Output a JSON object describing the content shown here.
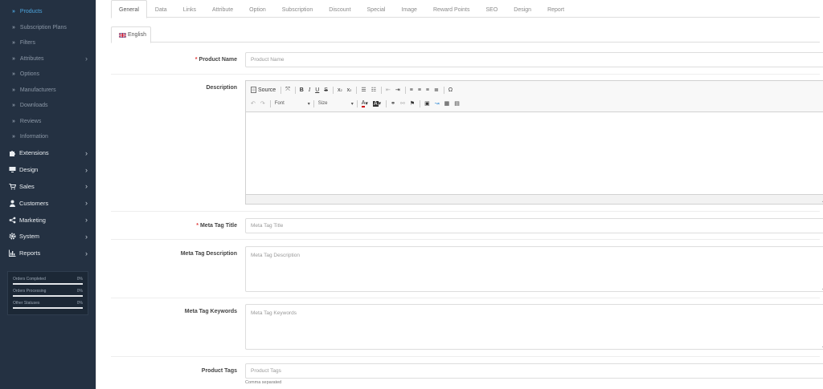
{
  "sidebar": {
    "catalog_sub_items": [
      {
        "label": "Products",
        "active": true,
        "has_arrow": false
      },
      {
        "label": "Subscription Plans",
        "active": false,
        "has_arrow": false
      },
      {
        "label": "Filters",
        "active": false,
        "has_arrow": false
      },
      {
        "label": "Attributes",
        "active": false,
        "has_arrow": true
      },
      {
        "label": "Options",
        "active": false,
        "has_arrow": false
      },
      {
        "label": "Manufacturers",
        "active": false,
        "has_arrow": false
      },
      {
        "label": "Downloads",
        "active": false,
        "has_arrow": false
      },
      {
        "label": "Reviews",
        "active": false,
        "has_arrow": false
      },
      {
        "label": "Information",
        "active": false,
        "has_arrow": false
      }
    ],
    "main_items": [
      {
        "label": "Extensions",
        "icon": "puzzle-icon"
      },
      {
        "label": "Design",
        "icon": "monitor-icon"
      },
      {
        "label": "Sales",
        "icon": "cart-icon"
      },
      {
        "label": "Customers",
        "icon": "user-icon"
      },
      {
        "label": "Marketing",
        "icon": "share-icon"
      },
      {
        "label": "System",
        "icon": "gear-icon"
      },
      {
        "label": "Reports",
        "icon": "chart-icon"
      }
    ],
    "stats": [
      {
        "label": "Orders Completed",
        "value": "0%"
      },
      {
        "label": "Orders Processing",
        "value": "0%"
      },
      {
        "label": "Other Statuses",
        "value": "0%"
      }
    ]
  },
  "tabs": [
    "General",
    "Data",
    "Links",
    "Attribute",
    "Option",
    "Subscription",
    "Discount",
    "Special",
    "Image",
    "Reward Points",
    "SEO",
    "Design",
    "Report"
  ],
  "active_tab": "General",
  "language_tab": "English",
  "form": {
    "product_name": {
      "label": "Product Name",
      "placeholder": "Product Name",
      "required": true
    },
    "description": {
      "label": "Description"
    },
    "meta_title": {
      "label": "Meta Tag Title",
      "placeholder": "Meta Tag Title",
      "required": true
    },
    "meta_description": {
      "label": "Meta Tag Description",
      "placeholder": "Meta Tag Description"
    },
    "meta_keywords": {
      "label": "Meta Tag Keywords",
      "placeholder": "Meta Tag Keywords"
    },
    "product_tags": {
      "label": "Product Tags",
      "placeholder": "Product Tags",
      "help": "Comma separated"
    }
  },
  "editor": {
    "source_label": "Source",
    "font_label": "Font",
    "size_label": "Size"
  },
  "colors": {
    "sidebar_bg": "#243142",
    "active_link": "#4da6df",
    "required": "#e03a3a"
  }
}
